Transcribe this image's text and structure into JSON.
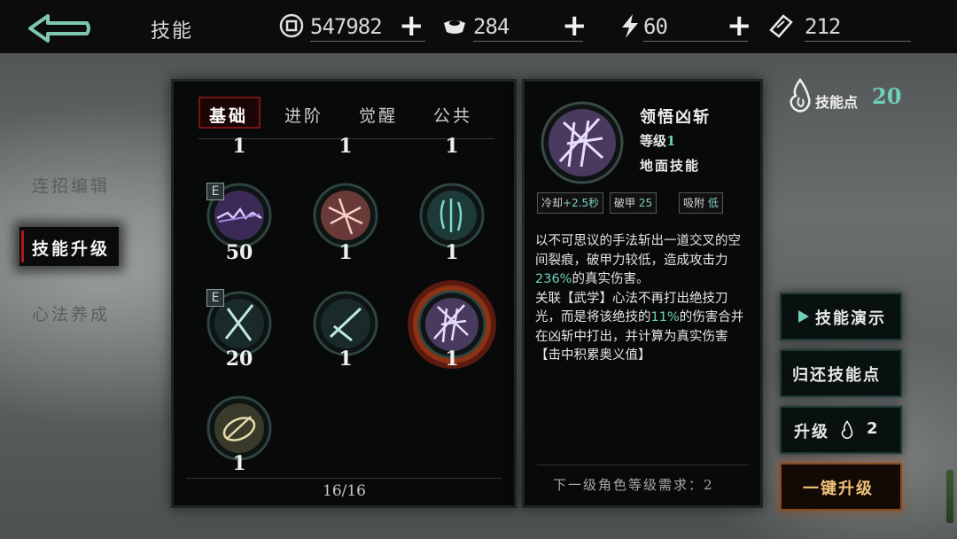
{
  "header": {
    "title": "技能",
    "resources": [
      {
        "icon": "coin-icon",
        "value": "547982",
        "has_add": true
      },
      {
        "icon": "silver-ingot-icon",
        "value": "284",
        "has_add": true
      },
      {
        "icon": "lightning-icon",
        "value": "60",
        "has_add": true
      },
      {
        "icon": "ticket-icon",
        "value": "212",
        "has_add": false
      }
    ]
  },
  "nav": {
    "items": [
      {
        "label": "连招编辑",
        "active": false
      },
      {
        "label": "技能升级",
        "active": true
      },
      {
        "label": "心法养成",
        "active": false
      }
    ]
  },
  "skills": {
    "tabs": [
      "基础",
      "进阶",
      "觉醒",
      "公共"
    ],
    "active_tab": "基础",
    "top_row_levels": [
      "1",
      "1",
      "1"
    ],
    "grid": [
      {
        "level": "50",
        "badge": "E",
        "icon": "purple-slash-skill-icon"
      },
      {
        "level": "1",
        "badge": "",
        "icon": "red-claw-skill-icon"
      },
      {
        "level": "1",
        "badge": "",
        "icon": "teal-wave-skill-icon"
      },
      {
        "level": "20",
        "badge": "E",
        "icon": "teal-cross-skill-icon"
      },
      {
        "level": "1",
        "badge": "",
        "icon": "teal-swords-skill-icon"
      },
      {
        "level": "1",
        "badge": "",
        "icon": "purple-rift-skill-icon",
        "selected": true
      },
      {
        "level": "1",
        "badge": "",
        "icon": "gold-ring-skill-icon"
      }
    ],
    "count": "16/16"
  },
  "detail": {
    "name": "领悟凶斩",
    "level_label": "等级",
    "level_value": "1",
    "type": "地面技能",
    "stats": [
      {
        "label": "冷却",
        "value": "+2.5秒"
      },
      {
        "label": "破甲",
        "value": "25"
      },
      {
        "label": "吸附",
        "value": "低"
      }
    ],
    "desc": {
      "p1": "以不可思议的手法斩出一道交叉的空间裂痕，破甲力较低，造成攻击力",
      "p1_hl": "236%",
      "p1_end": "的真实伤害。",
      "p2": "关联【武学】心法不再打出绝技刀光，而是将该绝技的",
      "p2_hl": "11%",
      "p2_end": "的伤害合并在凶斩中打出，并计算为真实伤害",
      "p3": "【击中积累奥义值】"
    },
    "requirement": "下一级角色等级需求：2"
  },
  "points": {
    "label": "技能点",
    "value": "20"
  },
  "buttons": {
    "demo": "技能演示",
    "refund": "归还技能点",
    "upgrade": "升级",
    "upgrade_cost": "2",
    "one_click": "一键升级"
  },
  "colors": {
    "accent_teal": "#6fd0b8",
    "active_red": "#b01818",
    "gold": "#f0c27a"
  }
}
